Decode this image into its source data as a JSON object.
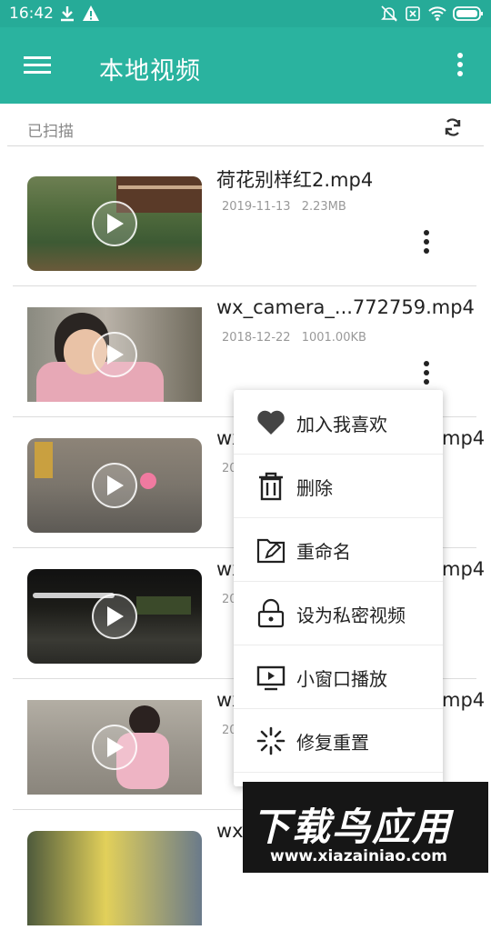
{
  "status_bar": {
    "time": "16:42",
    "icons": [
      "download-icon",
      "warning-icon",
      "mute-icon",
      "sim-icon",
      "wifi-icon",
      "battery-icon"
    ]
  },
  "app_bar": {
    "title": "本地视频",
    "menu_icon": "hamburger-menu-icon",
    "more_icon": "more-vertical-icon"
  },
  "scan": {
    "label": "已扫描",
    "refresh_icon": "refresh-icon"
  },
  "videos": [
    {
      "name": "荷花别样红2.mp4",
      "date": "2019-11-13",
      "size": "2.23MB"
    },
    {
      "name": "wx_camera_...772759.mp4",
      "date": "2018-12-22",
      "size": "1001.00KB"
    },
    {
      "name": "wx",
      "name_tail": "mp4",
      "date": "20"
    },
    {
      "name": "wx",
      "name_tail": "mp4",
      "date": "20"
    },
    {
      "name": "wx",
      "name_tail": "mp4",
      "date": "20"
    },
    {
      "name": "wx",
      "date": ""
    }
  ],
  "menu": {
    "items": [
      {
        "label": "加入我喜欢",
        "icon": "heart-icon"
      },
      {
        "label": "删除",
        "icon": "trash-icon"
      },
      {
        "label": "重命名",
        "icon": "rename-icon"
      },
      {
        "label": "设为私密视频",
        "icon": "lock-icon"
      },
      {
        "label": "小窗口播放",
        "icon": "mini-window-icon"
      },
      {
        "label": "修复重置",
        "icon": "repair-spinner-icon"
      }
    ]
  },
  "watermark": {
    "brand": "下载鸟应用",
    "url": "www.xiazainiao.com"
  },
  "colors": {
    "primary": "#2ab39f",
    "status_bar": "#26ab98"
  }
}
